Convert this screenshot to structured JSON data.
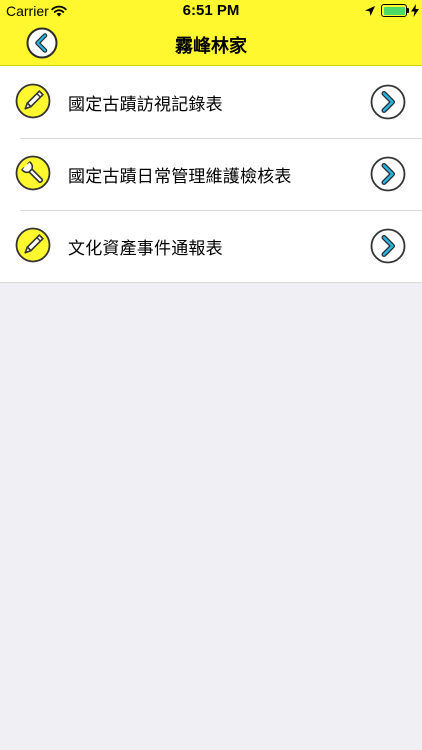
{
  "status_bar": {
    "carrier": "Carrier",
    "time": "6:51 PM",
    "battery_color": "#4cd964"
  },
  "nav": {
    "title": "霧峰林家",
    "back_icon": "chevron-left-icon",
    "bar_color": "#fff82e"
  },
  "list": {
    "items": [
      {
        "label": "國定古蹟訪視記錄表",
        "icon": "pencil-icon"
      },
      {
        "label": "國定古蹟日常管理維護檢核表",
        "icon": "wrench-icon"
      },
      {
        "label": "文化資產事件通報表",
        "icon": "pencil-icon"
      }
    ],
    "chevron_icon": "chevron-right-icon"
  }
}
